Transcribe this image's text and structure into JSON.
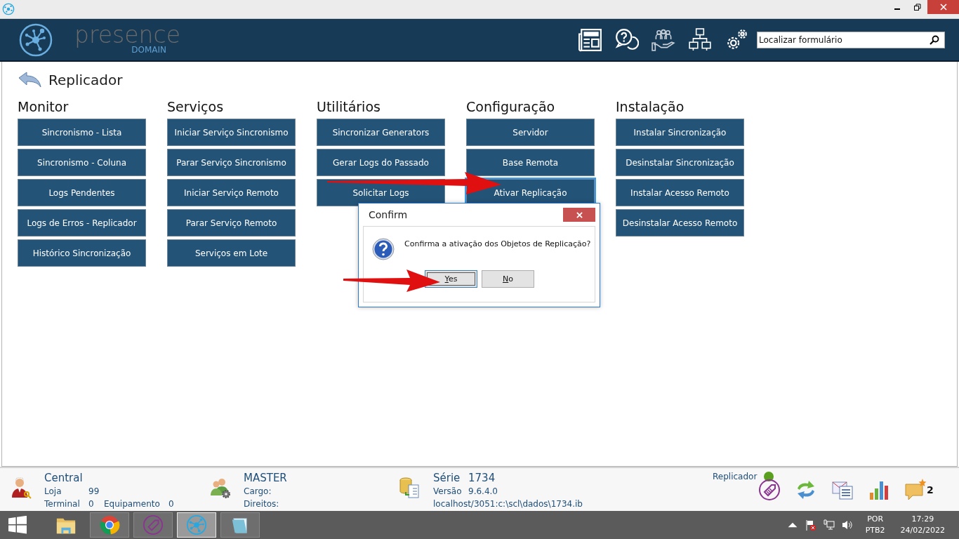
{
  "brand": {
    "name": "presence",
    "subtitle": "DOMAIN"
  },
  "search": {
    "placeholder": "Localizar formulário"
  },
  "page": {
    "title": "Replicador"
  },
  "groups": [
    {
      "title": "Monitor",
      "buttons": [
        {
          "label": "Sincronismo - Lista",
          "focused": false
        },
        {
          "label": "Sincronismo - Coluna",
          "focused": false
        },
        {
          "label": "Logs Pendentes",
          "focused": false
        },
        {
          "label": "Logs de Erros - Replicador",
          "focused": false
        },
        {
          "label": "Histórico Sincronização",
          "focused": false
        }
      ]
    },
    {
      "title": "Serviços",
      "buttons": [
        {
          "label": "Iniciar Serviço Sincronismo",
          "focused": false
        },
        {
          "label": "Parar Serviço Sincronismo",
          "focused": false
        },
        {
          "label": "Iniciar Serviço Remoto",
          "focused": false
        },
        {
          "label": "Parar Serviço Remoto",
          "focused": false
        },
        {
          "label": "Serviços em Lote",
          "focused": false
        }
      ]
    },
    {
      "title": "Utilitários",
      "buttons": [
        {
          "label": "Sincronizar Generators",
          "focused": false
        },
        {
          "label": "Gerar Logs do Passado",
          "focused": false
        },
        {
          "label": "Solicitar Logs",
          "focused": false
        }
      ]
    },
    {
      "title": "Configuração",
      "buttons": [
        {
          "label": "Servidor",
          "focused": false
        },
        {
          "label": "Base Remota",
          "focused": false
        },
        {
          "label": "Ativar Replicação",
          "focused": true
        }
      ]
    },
    {
      "title": "Instalação",
      "buttons": [
        {
          "label": "Instalar Sincronização",
          "focused": false
        },
        {
          "label": "Desinstalar Sincronização",
          "focused": false
        },
        {
          "label": "Instalar Acesso Remoto",
          "focused": false
        },
        {
          "label": "Desinstalar Acesso Remoto",
          "focused": false
        }
      ]
    }
  ],
  "dialog": {
    "title": "Confirm",
    "message": "Confirma a ativação dos Objetos de Replicação?",
    "buttons": [
      {
        "label": "Yes",
        "default": true
      },
      {
        "label": "No",
        "default": false
      }
    ]
  },
  "status_bar": {
    "store": {
      "name": "Central",
      "loja_label": "Loja",
      "loja": "99",
      "terminal_label": "Terminal",
      "terminal": "0",
      "equipamento_label": "Equipamento",
      "equipamento": "0"
    },
    "user": {
      "name": "MASTER",
      "cargo_label": "Cargo:",
      "direitos_label": "Direitos:"
    },
    "database": {
      "serie_label": "Série",
      "serie": "1734",
      "versao_label": "Versão",
      "versao": "9.6.4.0",
      "path": "localhost/3051:c:\\scl\\dados\\1734.ib"
    },
    "service": {
      "label": "Replicador",
      "color": "#5aa01e"
    },
    "notifications": "2"
  },
  "taskbar": {
    "apps": [
      {
        "kind": "folder",
        "active": false
      },
      {
        "kind": "chrome",
        "active": false
      },
      {
        "kind": "tag",
        "active": false
      },
      {
        "kind": "presence",
        "active": true
      },
      {
        "kind": "notepad",
        "active": false
      }
    ],
    "language": "POR",
    "layout": "PTB2",
    "time": "17:29",
    "date": "24/02/2022"
  }
}
